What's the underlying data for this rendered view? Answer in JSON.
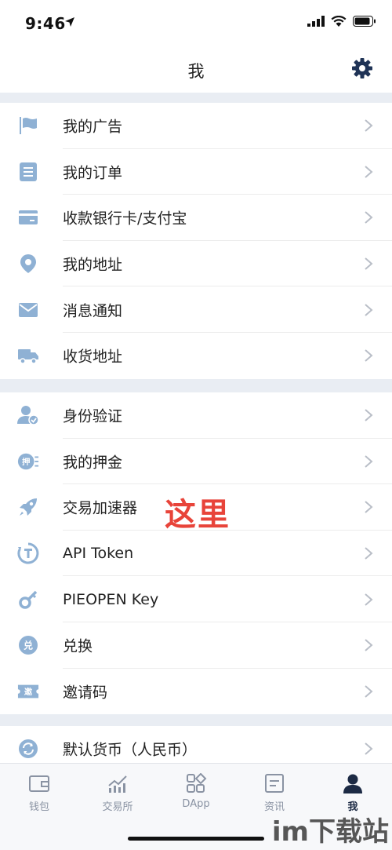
{
  "status": {
    "time": "9:46"
  },
  "header": {
    "title": "我"
  },
  "groups": [
    {
      "items": [
        {
          "label": "我的广告"
        },
        {
          "label": "我的订单"
        },
        {
          "label": "收款银行卡/支付宝"
        },
        {
          "label": "我的地址"
        },
        {
          "label": "消息通知"
        },
        {
          "label": "收货地址"
        }
      ]
    },
    {
      "items": [
        {
          "label": "身份验证"
        },
        {
          "label": "我的押金"
        },
        {
          "label": "交易加速器"
        },
        {
          "label": "API Token"
        },
        {
          "label": "PIEOPEN Key"
        },
        {
          "label": "兑换"
        },
        {
          "label": "邀请码"
        }
      ]
    },
    {
      "items": [
        {
          "label": "默认货币（人民币）"
        }
      ]
    }
  ],
  "annotation": "这里",
  "tabs": [
    {
      "label": "钱包",
      "icon": "wallet-icon"
    },
    {
      "label": "交易所",
      "icon": "exchange-chart-icon"
    },
    {
      "label": "DApp",
      "icon": "dapp-grid-icon"
    },
    {
      "label": "资讯",
      "icon": "news-icon"
    },
    {
      "label": "我",
      "icon": "profile-icon",
      "active": true
    }
  ],
  "watermark": "im下载站",
  "colors": {
    "icon": "#8fb1d4",
    "annotation": "#e8443a",
    "active_tab": "#1c2a44",
    "inactive_tab": "#8a93a3"
  }
}
